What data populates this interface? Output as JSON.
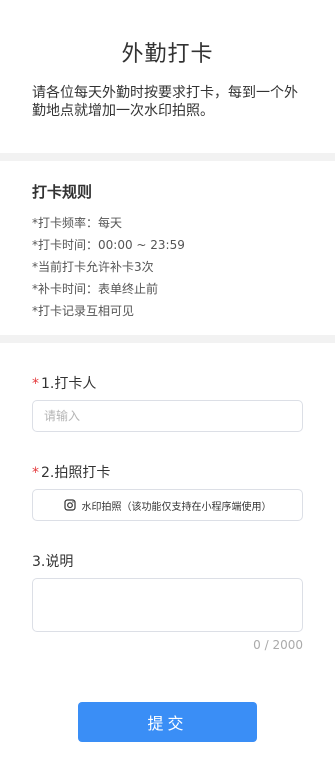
{
  "header": {
    "title": "外勤打卡",
    "intro": "请各位每天外勤时按要求打卡，每到一个外勤地点就增加一次水印拍照。"
  },
  "rules": {
    "title": "打卡规则",
    "items": [
      "*打卡频率：每天",
      "*打卡时间：00:00 ~ 23:59",
      "*当前打卡允许补卡3次",
      "*补卡时间：表单终止前",
      "*打卡记录互相可见"
    ]
  },
  "form": {
    "field1": {
      "required_mark": "*",
      "label": "1.打卡人",
      "placeholder": "请输入"
    },
    "field2": {
      "required_mark": "*",
      "label": "2.拍照打卡",
      "button_label": "水印拍照（该功能仅支持在小程序端使用）"
    },
    "field3": {
      "label": "3.说明",
      "counter": "0 / 2000"
    },
    "submit_label": "提交"
  }
}
